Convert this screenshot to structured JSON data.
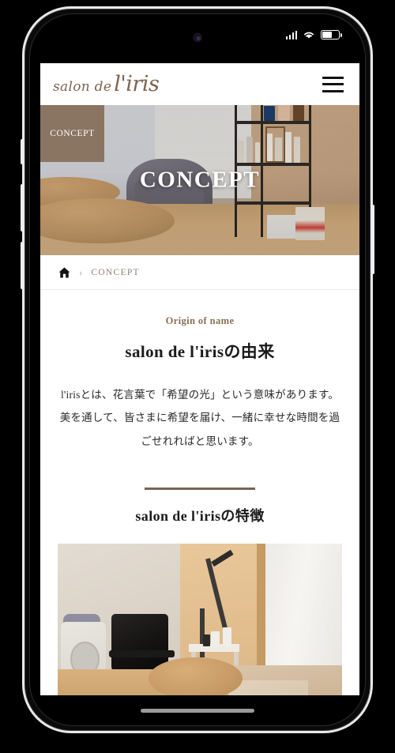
{
  "device": {
    "status_bar": {
      "cellular_icon": "cellular-signal-icon",
      "wifi_icon": "wifi-icon",
      "battery_icon": "battery-icon",
      "battery_level_percent": 60
    },
    "front_camera_icon": "front-camera-icon",
    "home_indicator": "home-indicator",
    "buttons": {
      "silence": "silence-switch",
      "volume_up": "volume-up-button",
      "volume_down": "volume-down-button",
      "power": "power-button"
    }
  },
  "site": {
    "logo": {
      "part_small": "salon de",
      "part_large": "l'iris",
      "color": "#7d6451"
    },
    "menu_icon": "hamburger-menu-icon"
  },
  "hero": {
    "category_badge": "CONCEPT",
    "title": "CONCEPT",
    "badge_color": "#8a7562",
    "photo_alt": "salon interior with armchair, cushions and product shelf"
  },
  "breadcrumb": {
    "home_icon": "home-icon",
    "separator": "›",
    "current": "CONCEPT",
    "current_color": "#8d7f75"
  },
  "main": {
    "eyebrow": "Origin of name",
    "eyebrow_color": "#8a6f52",
    "heading": "salon de l'irisの由来",
    "body": "l'irisとは、花言葉で「希望の光」という意味があります。美を通して、皆さまに希望を届け、一緒に幸せな時間を過ごせれればと思います。",
    "divider_color": "#7a6352",
    "features_heading": "salon de l'irisの特徴",
    "feature_photo_alt": "treatment room with massage bed, cushion and equipment"
  }
}
